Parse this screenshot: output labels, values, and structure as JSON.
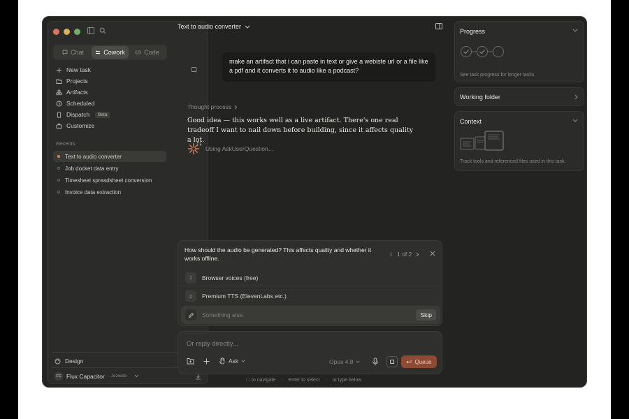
{
  "colors": {
    "accent": "#d9805c",
    "queue_bg": "#8e4a33",
    "window_bg": "#232321",
    "sidebar_bg": "#2b2b29"
  },
  "sidebar": {
    "mode_tabs": [
      {
        "label": "Chat",
        "icon": "chat-bubble-icon"
      },
      {
        "label": "Cowork",
        "icon": "cowork-icon",
        "active": true
      },
      {
        "label": "Code",
        "icon": "code-icon"
      }
    ],
    "nav": [
      {
        "label": "New task",
        "icon": "plus-icon"
      },
      {
        "label": "Projects",
        "icon": "folder-icon"
      },
      {
        "label": "Artifacts",
        "icon": "artifacts-icon"
      },
      {
        "label": "Scheduled",
        "icon": "clock-icon"
      },
      {
        "label": "Dispatch",
        "icon": "phone-icon",
        "badge": "Beta"
      },
      {
        "label": "Customize",
        "icon": "briefcase-icon"
      }
    ],
    "recents_label": "Recents",
    "recents": [
      {
        "label": "Text to audio converter",
        "active": true
      },
      {
        "label": "Job docket data entry"
      },
      {
        "label": "Timesheet spreadsheet conversion"
      },
      {
        "label": "Invoice data extraction"
      }
    ],
    "design_label": "Design",
    "user": {
      "initials": "FC",
      "name": "Flux Capacitor",
      "org": "· Jezweb"
    }
  },
  "main": {
    "title": "Text to audio converter",
    "user_message": "make an artifact that i can paste in text or give a webiste url or a file like a pdf and it converts it to audio like a podcast?",
    "thought_label": "Thought process",
    "assistant_text": "Good idea — this works well as a live artifact. There's one real tradeoff I want to nail down before building, since it affects quality a lot.",
    "tool_status": "Using AskUserQuestion..."
  },
  "question": {
    "text": "How should the audio be generated? This affects quality and whether it works offline.",
    "pager": "1 of 2",
    "options": [
      {
        "num": "1",
        "label": "Browser voices (free)"
      },
      {
        "num": "2",
        "label": "Premium TTS (ElevenLabs etc.)"
      }
    ],
    "other_placeholder": "Something else",
    "skip_label": "Skip"
  },
  "composer": {
    "placeholder": "Or reply directly...",
    "ask_label": "Ask",
    "model_label": "Opus 4.8",
    "queue_label": "Queue"
  },
  "hints": {
    "navigate": "↑↓ to navigate",
    "select": "Enter to select",
    "type": "or type below"
  },
  "right_panel": {
    "progress": {
      "title": "Progress",
      "note": "See task progress for longer tasks."
    },
    "working_folder": {
      "title": "Working folder"
    },
    "context": {
      "title": "Context",
      "note": "Track tools and referenced files used in this task."
    }
  }
}
